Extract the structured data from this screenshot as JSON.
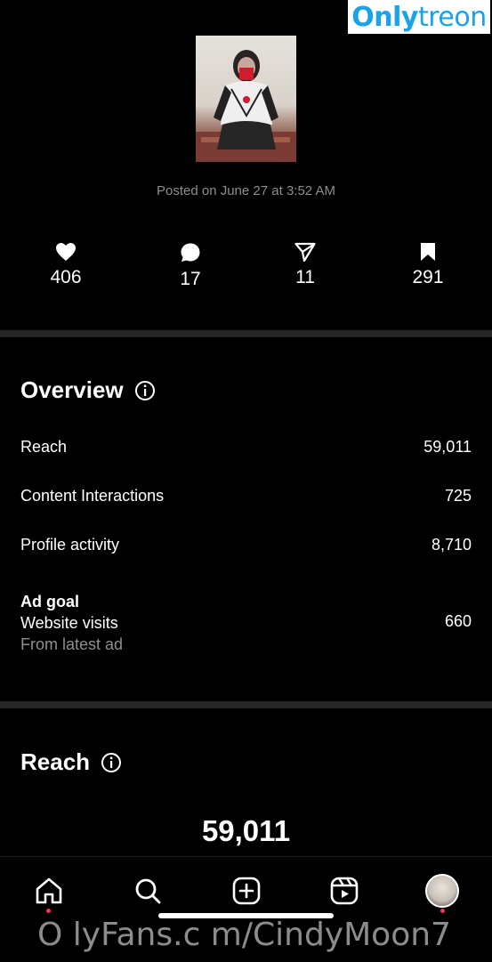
{
  "watermark_logo": {
    "part1": "Only",
    "part2": "treon"
  },
  "post": {
    "thumbnail_alt": "post-thumbnail",
    "posted_text": "Posted on June 27 at 3:52 AM"
  },
  "stats": [
    {
      "icon": "heart-icon",
      "value": "406"
    },
    {
      "icon": "comment-icon",
      "value": "17"
    },
    {
      "icon": "share-icon",
      "value": "11"
    },
    {
      "icon": "bookmark-icon",
      "value": "291"
    }
  ],
  "overview": {
    "title": "Overview",
    "rows": [
      {
        "label": "Reach",
        "value": "59,011"
      },
      {
        "label": "Content Interactions",
        "value": "725"
      },
      {
        "label": "Profile activity",
        "value": "8,710"
      }
    ],
    "ad_goal": {
      "title": "Ad goal",
      "label": "Website visits",
      "sub": "From latest ad",
      "value": "660"
    }
  },
  "reach": {
    "title": "Reach",
    "value": "59,011"
  },
  "nav": {
    "items": [
      "home-icon",
      "search-icon",
      "create-icon",
      "reels-icon",
      "profile-avatar"
    ]
  },
  "watermark_url": "O lyFans.c m/CindyMoon7",
  "colors": {
    "accent_dot": "#ff2d55",
    "divider": "#262626",
    "muted": "#8e8e93"
  }
}
